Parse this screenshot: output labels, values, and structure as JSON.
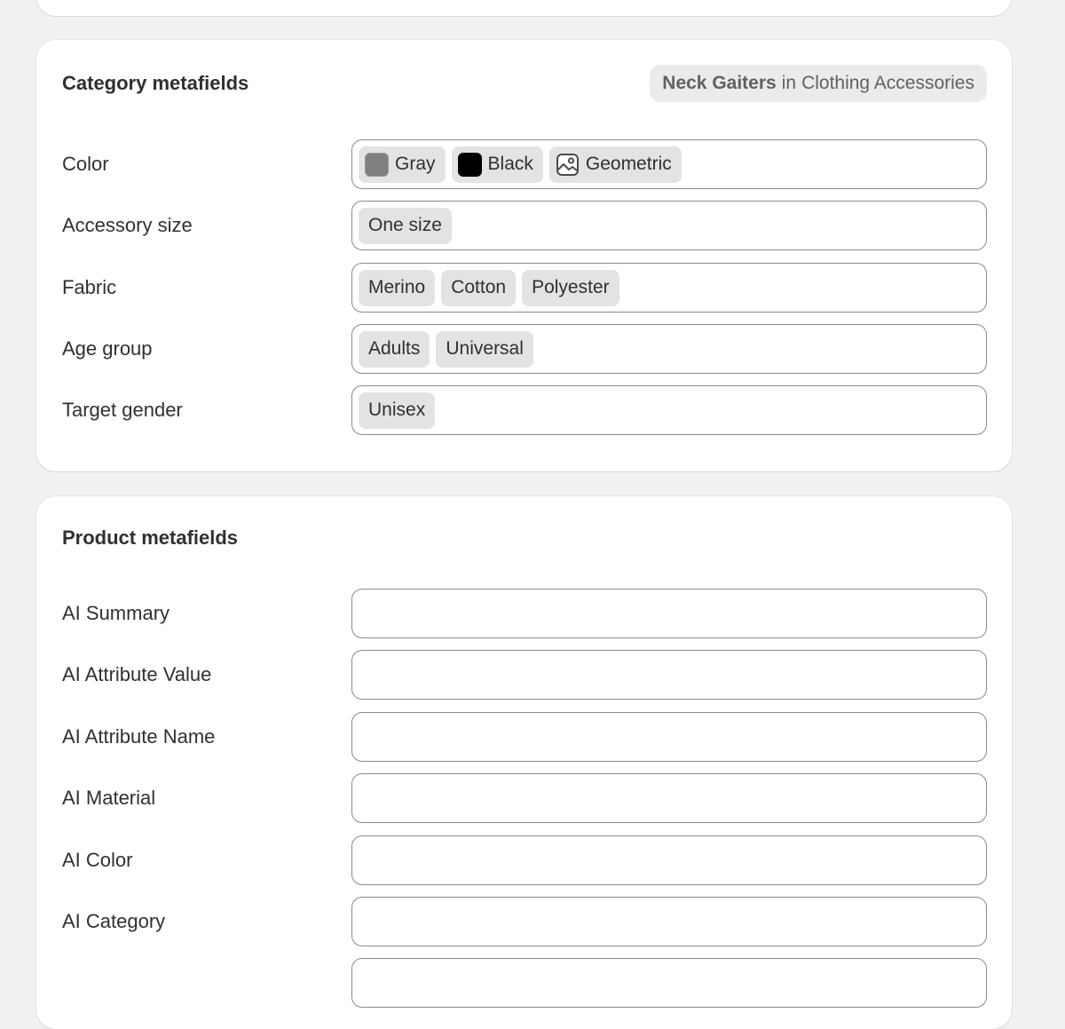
{
  "category_card": {
    "title": "Category metafields",
    "badge": {
      "category": "Neck Gaiters",
      "connector": "in",
      "parent": "Clothing Accessories"
    },
    "fields": [
      {
        "label": "Color",
        "tags": [
          {
            "label": "Gray",
            "swatch": "#7f7f7f"
          },
          {
            "label": "Black",
            "swatch": "#000000"
          },
          {
            "label": "Geometric",
            "icon": "pattern-image-icon"
          }
        ]
      },
      {
        "label": "Accessory size",
        "tags": [
          {
            "label": "One size"
          }
        ]
      },
      {
        "label": "Fabric",
        "tags": [
          {
            "label": "Merino"
          },
          {
            "label": "Cotton"
          },
          {
            "label": "Polyester"
          }
        ]
      },
      {
        "label": "Age group",
        "tags": [
          {
            "label": "Adults"
          },
          {
            "label": "Universal"
          }
        ]
      },
      {
        "label": "Target gender",
        "tags": [
          {
            "label": "Unisex"
          }
        ]
      }
    ]
  },
  "product_card": {
    "title": "Product metafields",
    "fields": [
      {
        "label": "AI Summary",
        "value": ""
      },
      {
        "label": "AI Attribute Value",
        "value": ""
      },
      {
        "label": "AI Attribute Name",
        "value": ""
      },
      {
        "label": "AI Material",
        "value": ""
      },
      {
        "label": "AI Color",
        "value": ""
      },
      {
        "label": "AI Category",
        "value": ""
      },
      {
        "label": "",
        "value": ""
      }
    ]
  },
  "colors": {
    "page_background": "#f1f1f1",
    "card_background": "#ffffff",
    "tag_background": "#e3e3e3",
    "field_border": "#8a8a8a",
    "text": "#303030",
    "muted_text": "#616161"
  }
}
